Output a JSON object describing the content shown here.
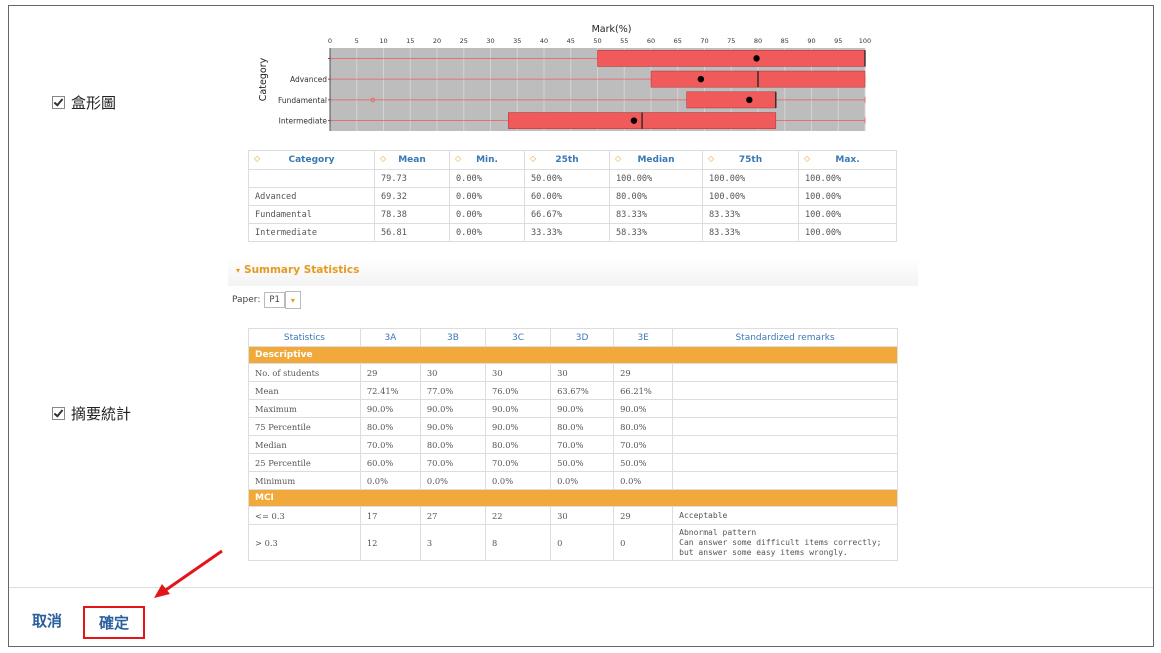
{
  "options": {
    "boxplot_label": "盒形圖",
    "summary_label": "摘要統計"
  },
  "chart_data": {
    "type": "box",
    "title": "Mark(%)",
    "xlabel": "Mark(%)",
    "ylabel": "Category",
    "xlim": [
      0,
      100
    ],
    "xticks": [
      0,
      5,
      10,
      15,
      20,
      25,
      30,
      35,
      40,
      45,
      50,
      55,
      60,
      65,
      70,
      75,
      80,
      85,
      90,
      95,
      100
    ],
    "categories": [
      "",
      "Advanced",
      "Fundamental",
      "Intermediate"
    ],
    "series": [
      {
        "category": "",
        "min": 0,
        "q1": 50,
        "median": 100,
        "q3": 100,
        "max": 100,
        "mean": 79.73
      },
      {
        "category": "Advanced",
        "min": 0,
        "q1": 60,
        "median": 80,
        "q3": 100,
        "max": 100,
        "mean": 69.32
      },
      {
        "category": "Fundamental",
        "min": 0,
        "q1": 66.67,
        "median": 83.33,
        "q3": 83.33,
        "max": 100,
        "mean": 78.38,
        "outlier": 8
      },
      {
        "category": "Intermediate",
        "min": 0,
        "q1": 33.33,
        "median": 58.33,
        "q3": 83.33,
        "max": 100,
        "mean": 56.81
      }
    ],
    "colors": {
      "box": "#f05a5a",
      "plot_bg": "#bdbdbd",
      "mean": "#000000"
    }
  },
  "boxtable": {
    "headers": [
      "Category",
      "Mean",
      "Min.",
      "25th",
      "Median",
      "75th",
      "Max."
    ],
    "rows": [
      [
        "",
        "79.73",
        "0.00%",
        "50.00%",
        "100.00%",
        "100.00%",
        "100.00%"
      ],
      [
        "Advanced",
        "69.32",
        "0.00%",
        "60.00%",
        "80.00%",
        "100.00%",
        "100.00%"
      ],
      [
        "Fundamental",
        "78.38",
        "0.00%",
        "66.67%",
        "83.33%",
        "83.33%",
        "100.00%"
      ],
      [
        "Intermediate",
        "56.81",
        "0.00%",
        "33.33%",
        "58.33%",
        "83.33%",
        "100.00%"
      ]
    ]
  },
  "summary": {
    "title": "Summary Statistics",
    "paper_label": "Paper:",
    "paper_value": "P1",
    "headers": [
      "Statistics",
      "3A",
      "3B",
      "3C",
      "3D",
      "3E",
      "Standardized remarks"
    ],
    "sections": [
      {
        "name": "Descriptive",
        "rows": [
          [
            "No. of students",
            "29",
            "30",
            "30",
            "30",
            "29",
            ""
          ],
          [
            "Mean",
            "72.41%",
            "77.0%",
            "76.0%",
            "63.67%",
            "66.21%",
            ""
          ],
          [
            "Maximum",
            "90.0%",
            "90.0%",
            "90.0%",
            "90.0%",
            "90.0%",
            ""
          ],
          [
            "75 Percentile",
            "80.0%",
            "90.0%",
            "90.0%",
            "80.0%",
            "80.0%",
            ""
          ],
          [
            "Median",
            "70.0%",
            "80.0%",
            "80.0%",
            "70.0%",
            "70.0%",
            ""
          ],
          [
            "25 Percentile",
            "60.0%",
            "70.0%",
            "70.0%",
            "50.0%",
            "50.0%",
            ""
          ],
          [
            "Minimum",
            "0.0%",
            "0.0%",
            "0.0%",
            "0.0%",
            "0.0%",
            ""
          ]
        ]
      },
      {
        "name": "MCI",
        "rows": [
          [
            "<= 0.3",
            "17",
            "27",
            "22",
            "30",
            "29",
            "Acceptable"
          ],
          [
            "> 0.3",
            "12",
            "3",
            "8",
            "0",
            "0",
            "Abnormal pattern\nCan answer some difficult items correctly;\nbut answer some easy items wrongly."
          ]
        ]
      }
    ]
  },
  "footer": {
    "cancel_label": "取消",
    "ok_label": "確定"
  },
  "colors": {
    "accent": "#e49b1f",
    "link": "#3a78b5",
    "highlight": "#e4141b"
  }
}
